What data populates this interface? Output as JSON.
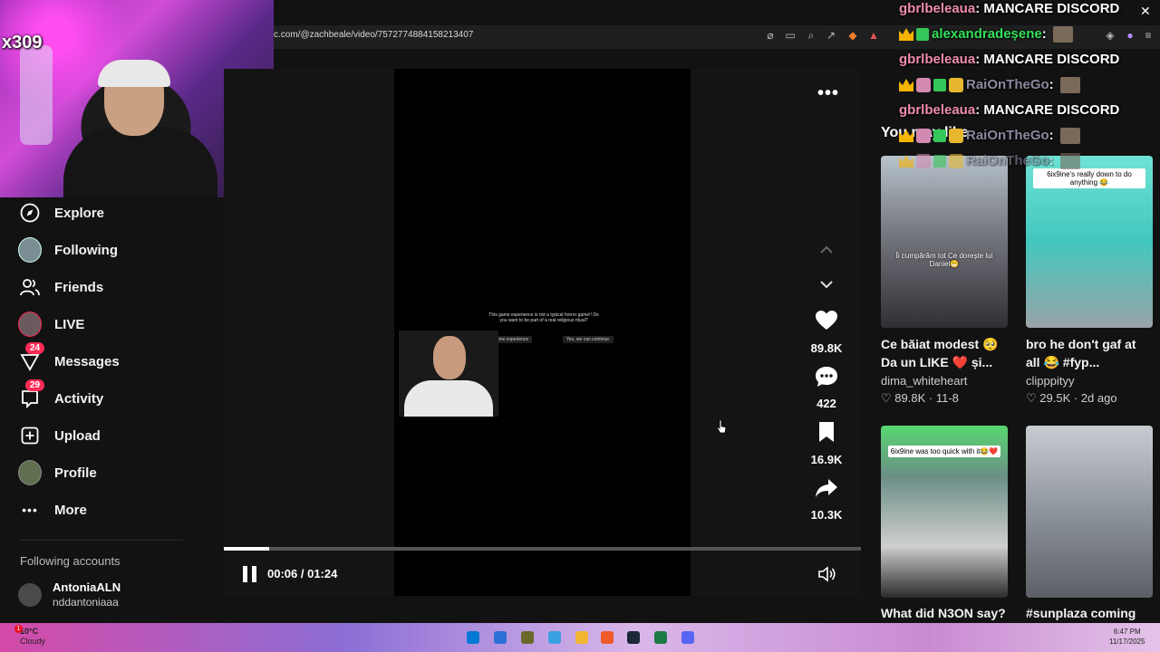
{
  "browser": {
    "url": "c.com/@zachbeale/video/7572774884158213407"
  },
  "stream": {
    "counter": "x309"
  },
  "nav": {
    "items": [
      {
        "label": "Explore",
        "icon": "compass-icon"
      },
      {
        "label": "Following",
        "icon": "following-avatar"
      },
      {
        "label": "Friends",
        "icon": "friends-icon"
      },
      {
        "label": "LIVE",
        "icon": "live-avatar"
      },
      {
        "label": "Messages",
        "icon": "messages-icon",
        "badge": "24"
      },
      {
        "label": "Activity",
        "icon": "activity-icon",
        "badge": "29"
      },
      {
        "label": "Upload",
        "icon": "upload-icon"
      },
      {
        "label": "Profile",
        "icon": "profile-avatar"
      },
      {
        "label": "More",
        "icon": "more-icon"
      }
    ],
    "following_accounts_label": "Following accounts",
    "account": {
      "name": "AntoniaALN",
      "handle": "nddantoniaaa"
    }
  },
  "video": {
    "overlay_question": "This game experience is not a typical horror game!! Do you want to be part of a real religious ritual?",
    "option_left": "a normal game experience",
    "option_right": "Yes, we can continue.",
    "time": "00:06 / 01:24",
    "progress": 0.071,
    "likes": "89.8K",
    "comments": "422",
    "saves": "16.9K",
    "shares": "10.3K",
    "author": "zachbeale"
  },
  "recommendations": {
    "heading": "You may like",
    "items": [
      {
        "caption": "Îi cumpărăm tot Ce dorește lui Daniel😁",
        "title": "Ce băiat modest 🥺 Da un LIKE ❤️ și...",
        "author": "dima_whiteheart",
        "likes": "89.8K",
        "date": "11-8",
        "bg": "#8d8f95"
      },
      {
        "caption": "6ix9ine's really down to do anything 😂",
        "title": "bro he don't gaf at all 😂 #fyp...",
        "author": "clipppityy",
        "likes": "29.5K",
        "date": "2d ago",
        "bg": "#4fd2c7"
      },
      {
        "caption": "6ix9ine was too quick with it😂❤️",
        "title": "What did N3ON say?",
        "author": "",
        "likes": "",
        "date": "",
        "bg": "#5aa878"
      },
      {
        "caption": "",
        "title": "#sunplaza coming",
        "author": "",
        "likes": "",
        "date": "",
        "bg": "#8a9099"
      }
    ]
  },
  "chat": [
    {
      "user": "gbrlbeleaua",
      "message": "MANCARE DISCORD",
      "color": "pink"
    },
    {
      "user": "alexandradeșene",
      "message": "",
      "color": "green"
    },
    {
      "user": "gbrlbeleaua",
      "message": "MANCARE DISCORD",
      "color": "pink"
    },
    {
      "user": "RaiOnTheGo",
      "message": "",
      "color": "gray"
    },
    {
      "user": "gbrlbeleaua",
      "message": "MANCARE DISCORD",
      "color": "pink"
    },
    {
      "user": "RaiOnTheGo",
      "message": "",
      "color": "gray"
    },
    {
      "user": "RaiOnTheGo",
      "message": "",
      "color": "gray"
    }
  ],
  "taskbar": {
    "temp": "10°C",
    "weather": "Cloudy",
    "time": "6:47 PM",
    "date": "11/17/2025",
    "notification": "1"
  },
  "colors": {
    "accent": "#fe2c55",
    "background": "#121212"
  }
}
